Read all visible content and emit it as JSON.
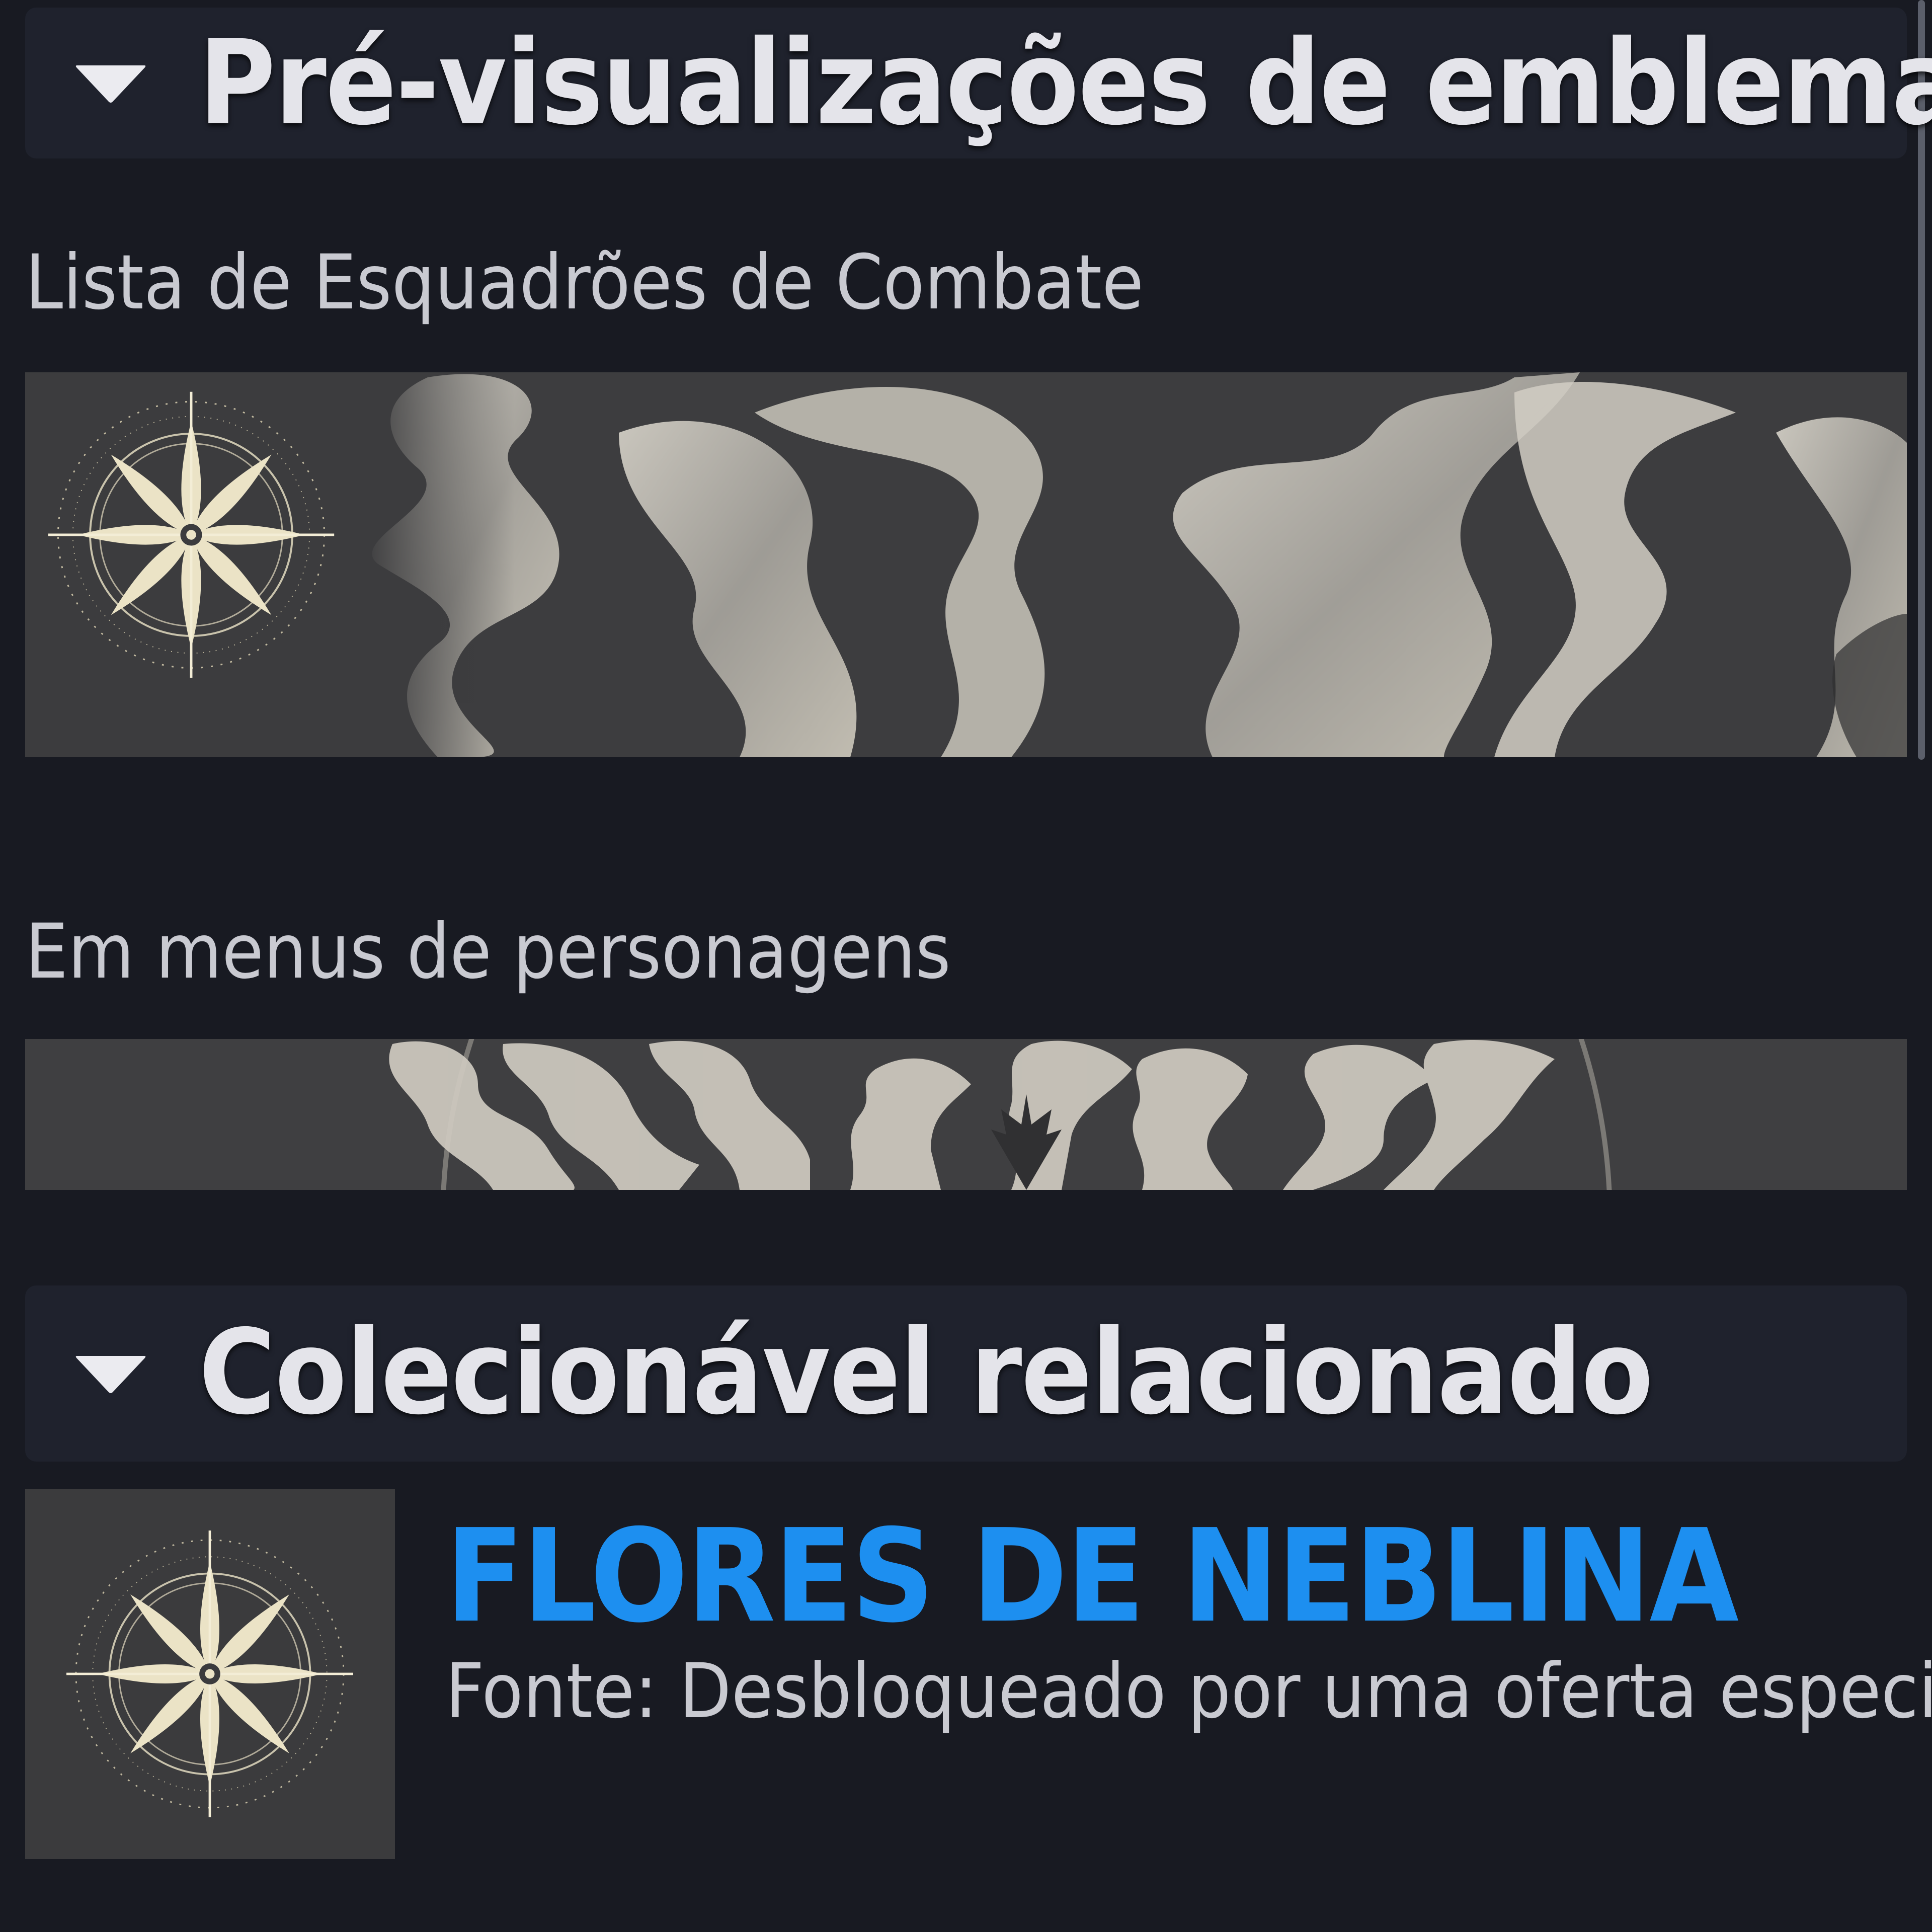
{
  "emblem_previews": {
    "title": "Pré-visualizações de emblemas",
    "roster_label": "Lista de Esquadrões de Combate",
    "character_label": "Em menus de personagens"
  },
  "related_collectible": {
    "title": "Colecionável relacionado",
    "item_name": "FLORES DE NEBLINA",
    "item_source": "Fonte: Desbloqueado por uma oferta especial."
  },
  "icons": {
    "collapse": "triangle-down-icon",
    "emblem": "eight-petal-star-emblem-icon"
  },
  "colors": {
    "background": "#181a22",
    "header_background": "#1f222d",
    "accent_blue": "#1d8ff0",
    "emblem_gold": "#e8e0c2"
  }
}
